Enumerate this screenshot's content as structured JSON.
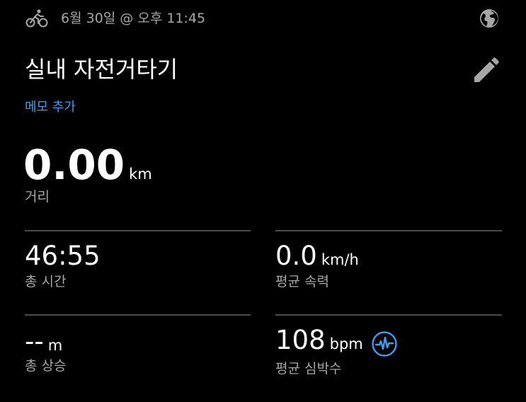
{
  "header": {
    "activity_icon": "bicycle-icon",
    "date": "6월 30일 @ 오후 11:45",
    "globe_icon": "globe-icon"
  },
  "activity": {
    "title": "실내 자전거타기",
    "edit_icon": "pencil-icon",
    "memo_link": "메모 추가"
  },
  "distance": {
    "value": "0.00",
    "unit": "km",
    "label": "거리"
  },
  "metrics": {
    "total_time": {
      "value": "46:55",
      "unit": "",
      "label": "총 시간"
    },
    "avg_speed": {
      "value": "0.0",
      "unit": "km/h",
      "label": "평균 속력"
    },
    "total_ascent": {
      "value": "--",
      "unit": "m",
      "label": "총 상승"
    },
    "avg_heart_rate": {
      "value": "108",
      "unit": "bpm",
      "label": "평균 심박수",
      "icon": "heart-rate-icon"
    }
  },
  "colors": {
    "background": "#000000",
    "text_primary": "#ffffff",
    "text_secondary": "#a6a6a6",
    "accent": "#3d9ef0",
    "divider": "#4a4a4a"
  }
}
